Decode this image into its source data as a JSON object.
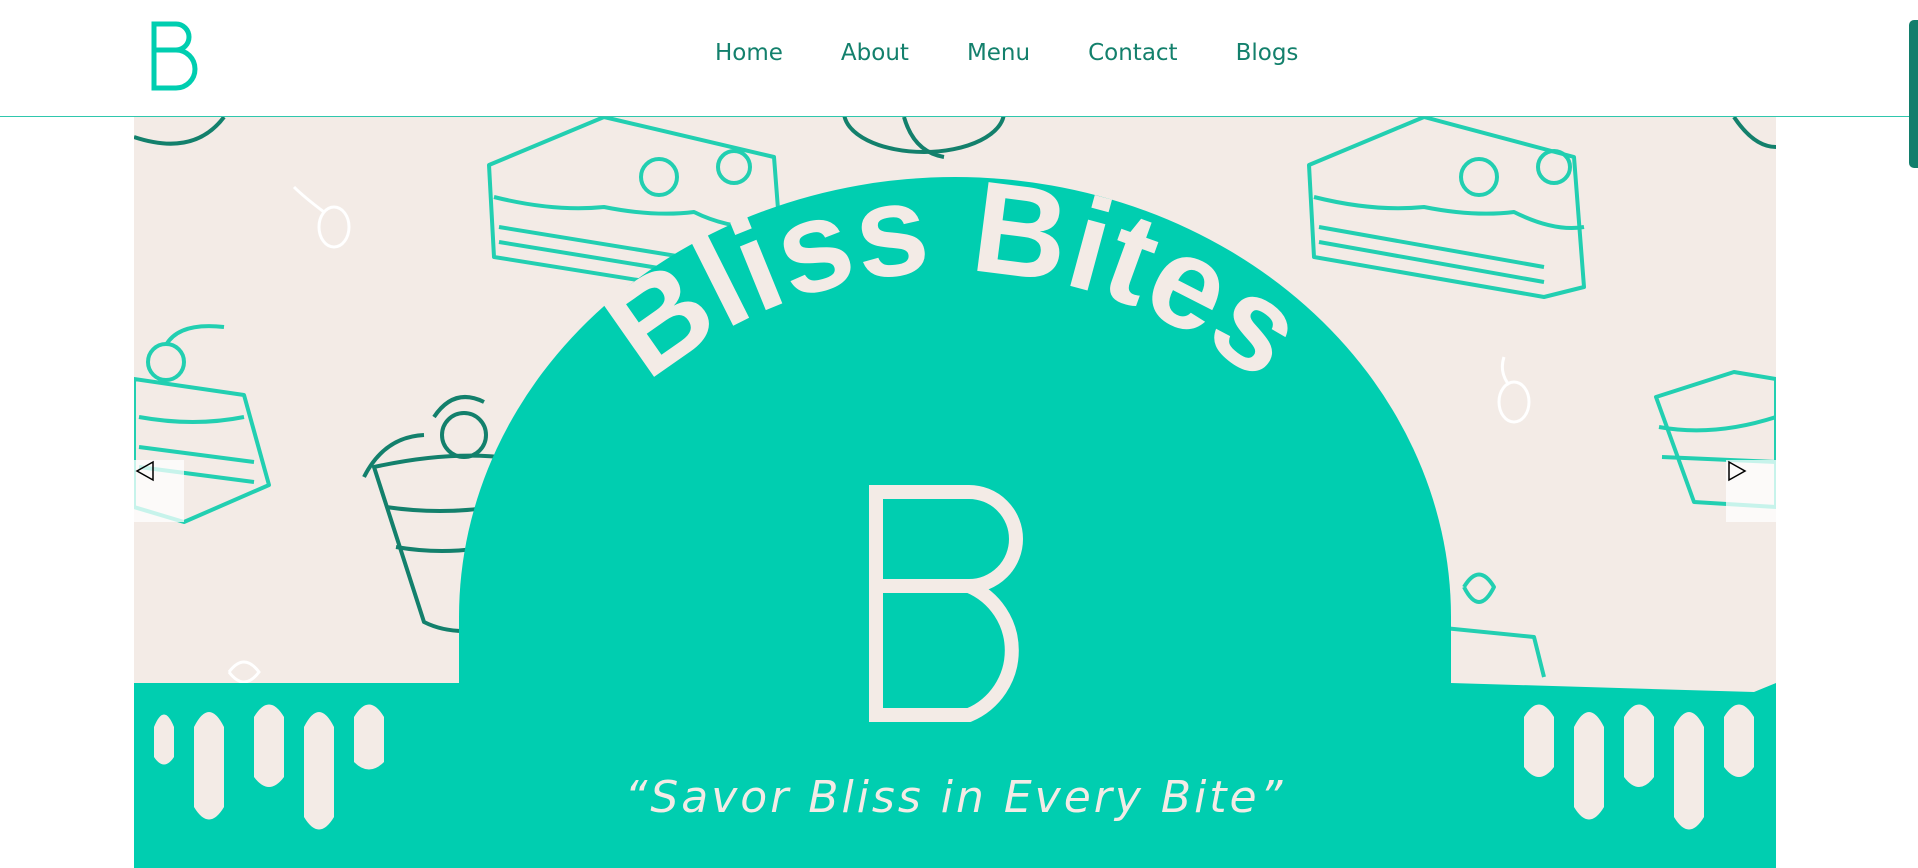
{
  "brand": {
    "logo_icon": "bliss-bites-b-logo-icon"
  },
  "nav": {
    "items": [
      {
        "label": "Home"
      },
      {
        "label": "About"
      },
      {
        "label": "Menu"
      },
      {
        "label": "Contact"
      },
      {
        "label": "Blogs"
      }
    ]
  },
  "hero": {
    "title": "Bliss Bites",
    "tagline": "“Savor Bliss in Every Bite”",
    "prev_icon": "triangle-left-icon",
    "next_icon": "triangle-right-icon"
  },
  "colors": {
    "teal": "#00ceb0",
    "dark_teal": "#13806c",
    "cream": "#f3ebe6",
    "white": "#ffffff"
  }
}
